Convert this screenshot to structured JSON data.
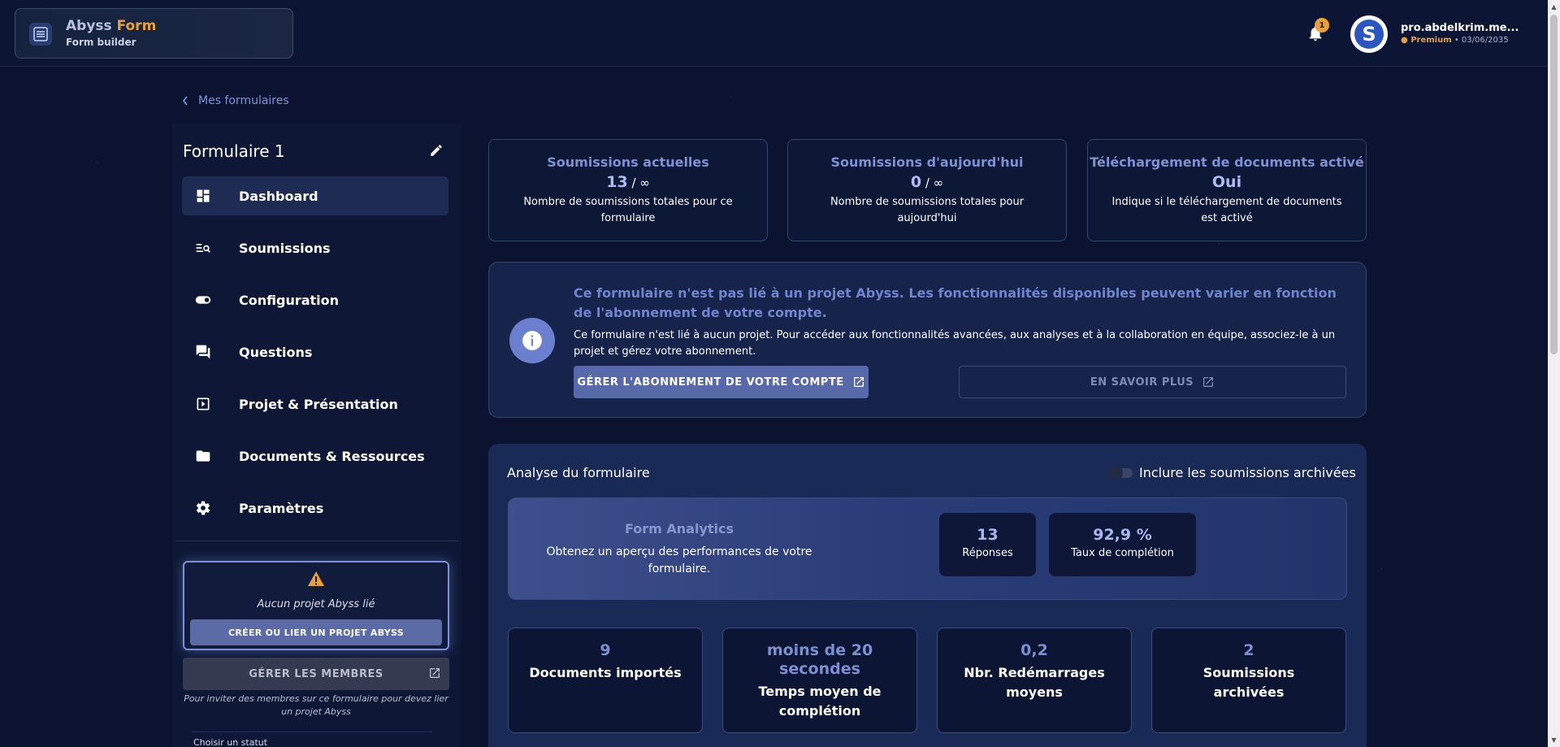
{
  "header": {
    "brand_title_a": "Abyss ",
    "brand_title_b": "Form",
    "brand_sub": "Form builder",
    "notif_count": "1",
    "avatar_letter": "S",
    "user_name": "pro.abdelkrim.me...",
    "user_plan": "Premium",
    "user_date": "• 03/06/2035"
  },
  "breadcrumb": {
    "label": "Mes formulaires"
  },
  "sidebar": {
    "form_title": "Formulaire 1",
    "items": [
      {
        "label": "Dashboard"
      },
      {
        "label": "Soumissions"
      },
      {
        "label": "Configuration"
      },
      {
        "label": "Questions"
      },
      {
        "label": "Projet & Présentation"
      },
      {
        "label": "Documents & Ressources"
      },
      {
        "label": "Paramètres"
      }
    ],
    "no_project": "Aucun projet Abyss lié",
    "create_btn": "CRÉER OU LIER UN PROJET ABYSS",
    "members_btn": "GÉRER LES MEMBRES",
    "members_hint": "Pour inviter des membres sur ce formulaire pour devez lier un projet Abyss",
    "status_label": "Choisir un statut"
  },
  "stats": [
    {
      "title": "Soumissions actuelles",
      "value": "13",
      "unit": " / ∞",
      "desc": "Nombre de soumissions totales pour ce formulaire"
    },
    {
      "title": "Soumissions d'aujourd'hui",
      "value": "0",
      "unit": " / ∞",
      "desc": "Nombre de soumissions totales pour aujourd'hui"
    },
    {
      "title": "Téléchargement de documents activé",
      "value": "Oui",
      "unit": "",
      "desc": "Indique si le téléchargement de documents est activé"
    }
  ],
  "info": {
    "title": "Ce formulaire n'est pas lié à un projet Abyss. Les fonctionnalités disponibles peuvent varier en fonction de l'abonnement de votre compte.",
    "text": "Ce formulaire n'est lié à aucun projet. Pour accéder aux fonctionnalités avancées, aux analyses et à la collaboration en équipe, associez-le à un projet et gérez votre abonnement.",
    "manage_btn": "GÉRER L'ABONNEMENT DE VOTRE COMPTE",
    "learn_btn": "EN SAVOIR PLUS"
  },
  "analysis": {
    "title": "Analyse du formulaire",
    "toggle_label": "Inclure les soumissions archivées",
    "fa_title": "Form Analytics",
    "fa_desc": "Obtenez un aperçu des performances de votre formulaire.",
    "kpis": [
      {
        "value": "13",
        "label": "Réponses"
      },
      {
        "value": "92,9 %",
        "label": "Taux de complétion"
      }
    ],
    "metrics": [
      {
        "value": "9",
        "label": "Documents importés"
      },
      {
        "value": "moins de 20 secondes",
        "label": "Temps moyen de complétion"
      },
      {
        "value": "0,2",
        "label": "Nbr. Redémarrages moyens"
      },
      {
        "value": "2",
        "label": "Soumissions archivées"
      }
    ]
  },
  "colors": {
    "accent": "#e8a13a",
    "primary": "#5869aa",
    "bg": "#0b1330"
  }
}
